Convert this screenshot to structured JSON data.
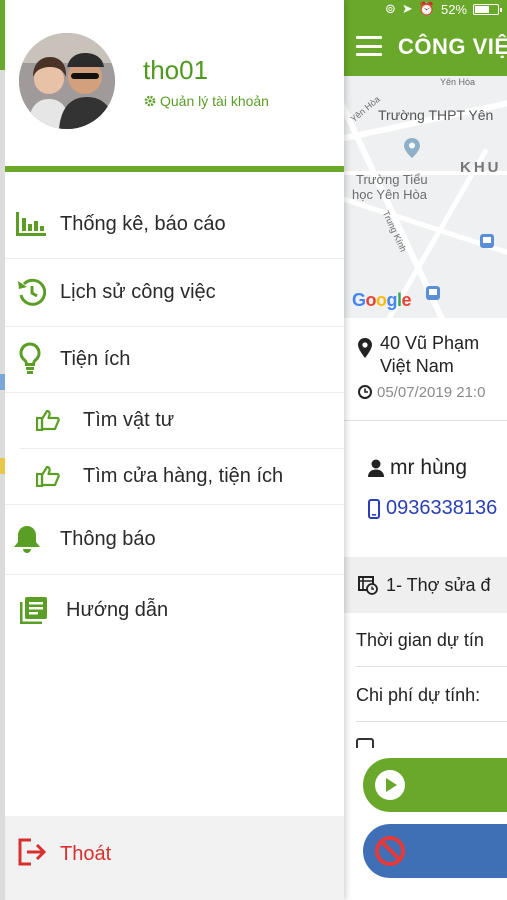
{
  "status_bar": {
    "battery": "52%"
  },
  "app_bar": {
    "title": "CÔNG VIỆ"
  },
  "map": {
    "labels": [
      "Yên Hòa",
      "Trường THPT Yên",
      "Trường Tiểu",
      "học Yên Hòa",
      "KHU",
      "Trung Kính",
      "Yên Hòa"
    ],
    "brand": "Google"
  },
  "job": {
    "address_line1": "40 Vũ Phạm",
    "address_line2": "Việt Nam",
    "date": "05/07/2019 21:0",
    "customer": "mr hùng",
    "phone": "0936338136",
    "section_title": "1- Thợ sửa đ",
    "row_estimated_time": "Thời gian dự tín",
    "row_estimated_cost": "Chi phí dự tính:"
  },
  "drawer": {
    "username": "tho01",
    "account_link": "Quản lý tài khoản",
    "items": [
      {
        "label": "Thống kê, báo cáo",
        "icon": "bar-chart-icon"
      },
      {
        "label": "Lịch sử công việc",
        "icon": "history-icon"
      },
      {
        "label": "Tiện ích",
        "icon": "lightbulb-icon"
      },
      {
        "label": "Tìm vật tư",
        "icon": "thumbs-up-icon"
      },
      {
        "label": "Tìm cửa hàng, tiện ích",
        "icon": "thumbs-up-icon"
      },
      {
        "label": "Thông báo",
        "icon": "bell-icon"
      },
      {
        "label": "Hướng dẫn",
        "icon": "book-icon"
      }
    ],
    "logout": "Thoát"
  },
  "colors": {
    "brand_green": "#6aa82b",
    "danger_red": "#d8302f",
    "link_blue": "#2a3fb5"
  }
}
